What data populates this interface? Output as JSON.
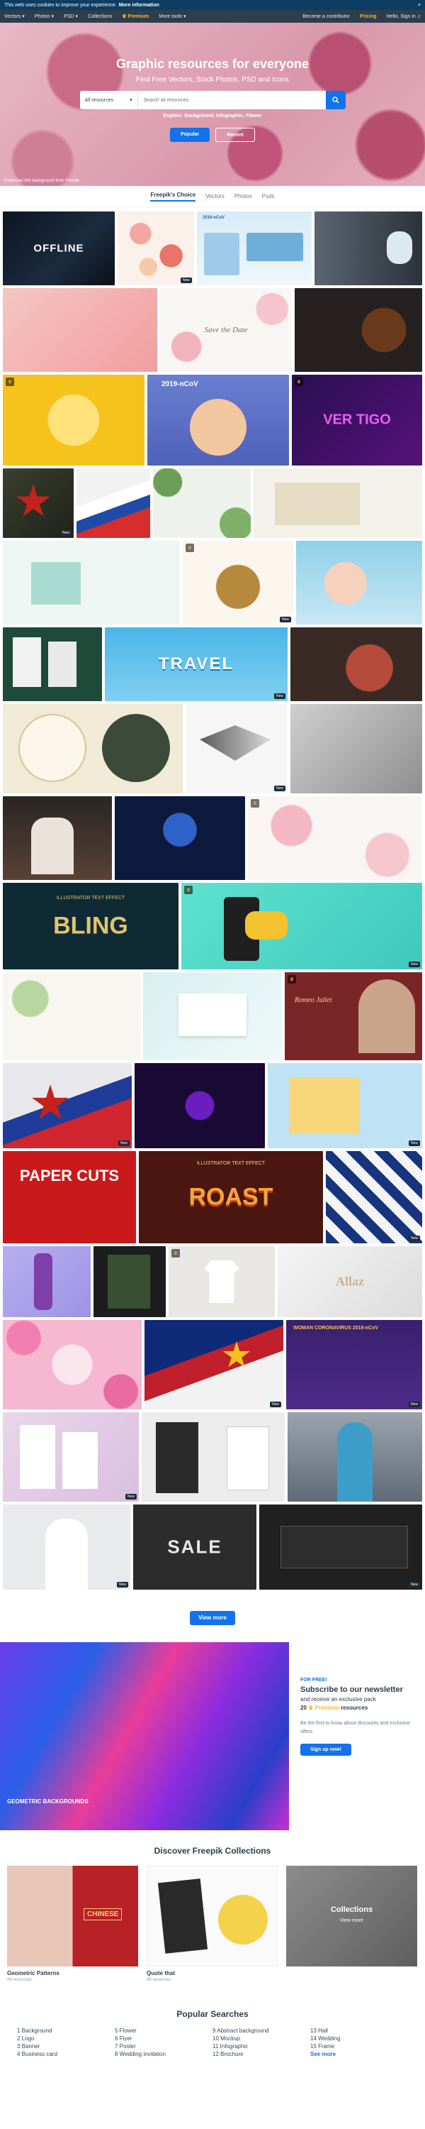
{
  "cookie": {
    "text": "This web uses cookies to improve your experience.",
    "link": "More information",
    "close": "×"
  },
  "nav": {
    "items": [
      "Vectors ▾",
      "Photos ▾",
      "PSD ▾",
      "Collections"
    ],
    "premium": "♛ Premium",
    "more": "More tools ▾",
    "contributor": "Become a contributor",
    "pricing": "Pricing",
    "signin": "Hello, Sign in ♫"
  },
  "hero": {
    "title": "Graphic resources for everyone",
    "subtitle": "Find Free Vectors, Stock Photos, PSD and Icons",
    "select": "All resources",
    "placeholder": "Search all resources",
    "explore_label": "Explore:",
    "explore_links": "Background, Infographic, Flower",
    "popular": "Popular",
    "recent": "Recent",
    "credit": "Download this background from Freepik"
  },
  "tabs": [
    "Freepik's Choice",
    "Vectors",
    "Photos",
    "Psds"
  ],
  "tiles": {
    "offline": "OFFLINE",
    "save": "Save the Date",
    "vertigo": "VER TIGO",
    "travel": "TRAVEL",
    "bling": "BLING",
    "illustrator": "ILLUSTRATOR TEXT EFFECT",
    "romeo": "Romeo Juliet",
    "paper": "PAPER CUTS",
    "roast": "ROAST",
    "allaz": "Allaz",
    "ncov": "2019-nCoV",
    "woman": "WOMAN CORONAVIRUS 2019-nCoV",
    "sale": "SALE",
    "new": "New"
  },
  "viewmore": "View more",
  "newsletter": {
    "forfree": "FOR FREE!",
    "title": "Subscribe to our newsletter",
    "line2": "and receive an exclusive pack",
    "line3a": "20",
    "line3b": "Premium",
    "line3c": "resources",
    "desc": "Be the first to know about discounts and exclusive offers",
    "button": "Sign up now!",
    "geo": "GEOMETRIC BACKGROUNDS"
  },
  "collections": {
    "title": "Discover Freepik Collections",
    "items": [
      {
        "name": "Geometric Patterns",
        "count": "89 resources",
        "badge": "CHINESE"
      },
      {
        "name": "Quote that",
        "count": "89 resources",
        "badge": ""
      }
    ],
    "overlay": "Collections",
    "overlay_sub": "View more"
  },
  "popular": {
    "title": "Popular Searches",
    "columns": [
      [
        "1  Background",
        "2  Logo",
        "3  Banner",
        "4  Business card"
      ],
      [
        "5  Flower",
        "6  Flyer",
        "7  Poster",
        "8  Wedding invitation"
      ],
      [
        "9  Abstract background",
        "10  Mockup",
        "11  Infographic",
        "12  Brochure"
      ],
      [
        "13  Hall",
        "14  Wedding",
        "15  Frame",
        "See more"
      ]
    ]
  },
  "colors": {
    "accent": "#1273eb",
    "nav": "#2d3e4c",
    "premium": "#fcb72c"
  }
}
